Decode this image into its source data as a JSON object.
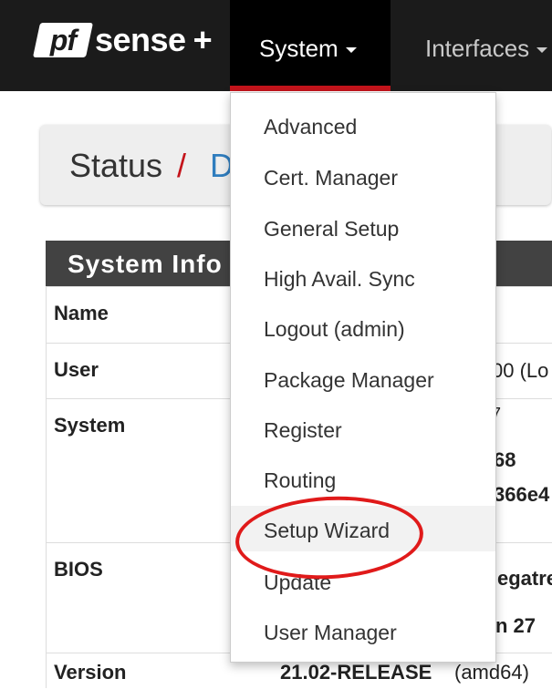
{
  "navbar": {
    "logo_pf": "pf",
    "logo_sense": "sense",
    "logo_plus": "+",
    "system_label": "System",
    "interfaces_label": "Interfaces",
    "active_color": "#c4141b"
  },
  "breadcrumb": {
    "status": "Status",
    "separator": "/",
    "current_partial": "D"
  },
  "panel": {
    "title": "System Info",
    "rows": [
      {
        "label": "Name",
        "values": []
      },
      {
        "label": "User",
        "values": [
          "00 (Lo"
        ]
      },
      {
        "label": "System",
        "values": [
          "7",
          "68",
          "366e4"
        ]
      },
      {
        "label": "BIOS",
        "values": [
          "egatre",
          "n 27"
        ]
      },
      {
        "label": "Version",
        "values": [
          "21.02-RELEASE",
          "(amd64)"
        ]
      }
    ]
  },
  "system_menu": {
    "items": [
      "Advanced",
      "Cert. Manager",
      "General Setup",
      "High Avail. Sync",
      "Logout (admin)",
      "Package Manager",
      "Register",
      "Routing",
      "Setup Wizard",
      "Update",
      "User Manager"
    ],
    "highlighted": "Setup Wizard"
  },
  "annotation": {
    "color": "#e01a1a"
  }
}
